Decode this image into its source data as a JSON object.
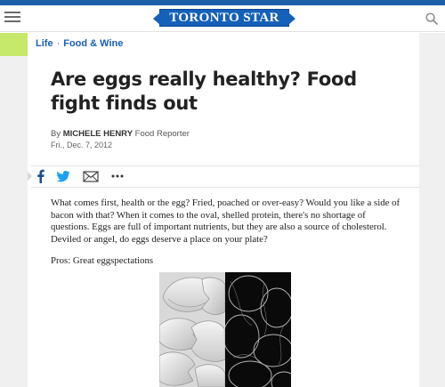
{
  "header": {
    "logo_text": "TORONTO STAR",
    "menu_icon": "hamburger-menu-icon",
    "search_icon": "search-icon",
    "brand_color": "#1560b8"
  },
  "breadcrumb": {
    "section": "Life",
    "subsection": "Food & Wine",
    "separator": "·",
    "tab_color": "#c6e86b"
  },
  "article": {
    "headline": "Are eggs really healthy? Food fight finds out",
    "byline_prefix": "By",
    "author": "MICHELE HENRY",
    "author_role": "Food Reporter",
    "date": "Fri., Dec. 7, 2012",
    "body": "What comes first, health or the egg? Fried, poached or over-easy? Would you like a side of bacon with that? When it comes to the oval, shelled protein, there's no shortage of questions. Eggs are full of important nutrients, but they are also a source of cholesterol. Deviled or angel, do eggs deserve a place on your plate?",
    "pros_heading": "Pros: Great eggspectations",
    "image_subject": "cracked egg shells"
  },
  "share": {
    "icons": [
      "facebook-icon",
      "twitter-icon",
      "email-icon",
      "more-options-icon"
    ],
    "facebook_color": "#1f4e8f",
    "twitter_color": "#1da1f2"
  }
}
